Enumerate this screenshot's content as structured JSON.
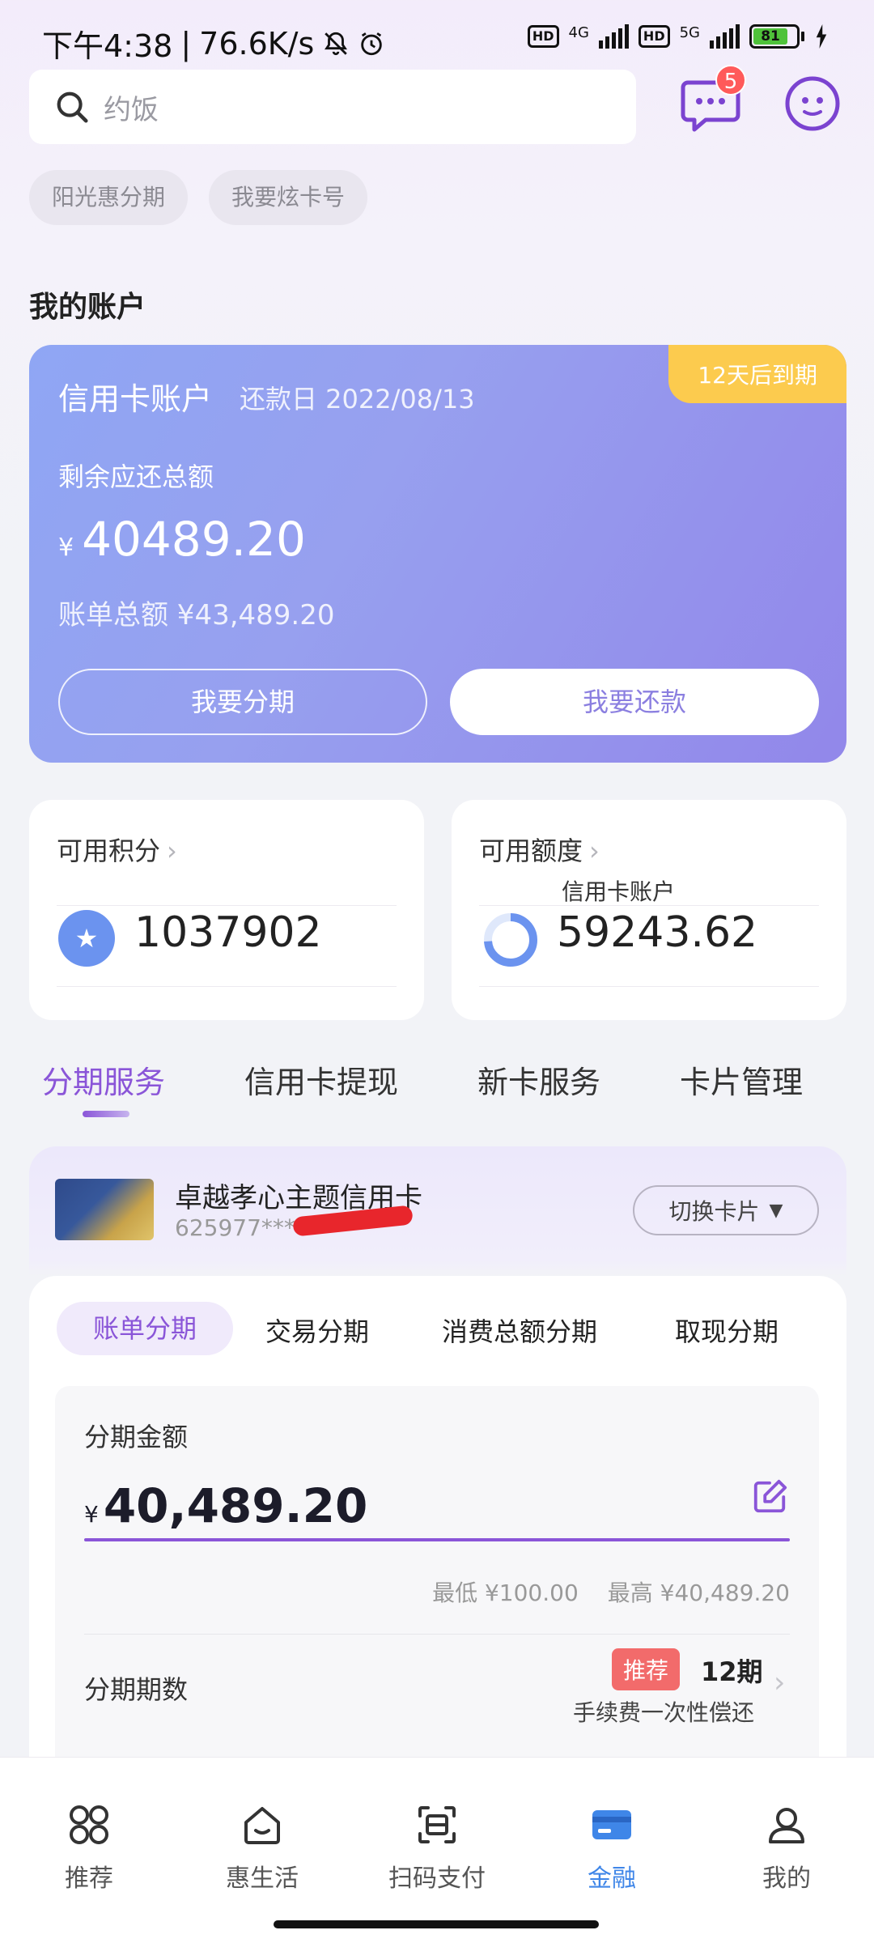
{
  "status_bar": {
    "time": "下午4:38",
    "speed": "76.6K/s",
    "net1": "4G",
    "net2": "5G",
    "hd": "HD",
    "battery": "81"
  },
  "search": {
    "placeholder": "约饭"
  },
  "messages": {
    "badge_count": "5"
  },
  "chips": [
    "阳光惠分期",
    "我要炫卡号"
  ],
  "account_section": {
    "title": "我的账户"
  },
  "account_card": {
    "title": "信用卡账户",
    "due_date": "还款日 2022/08/13",
    "due_tag": "12天后到期",
    "remaining_label": "剩余应还总额",
    "currency": "¥",
    "remaining_amount": "40489.20",
    "bill_total": "账单总额  ¥43,489.20",
    "installment_button": "我要分期",
    "repay_button": "我要还款"
  },
  "points_card": {
    "title": "可用积分",
    "value": "1037902",
    "chevron": "›"
  },
  "limit_card": {
    "title": "可用额度",
    "subtitle": "信用卡账户",
    "value": "59243.62",
    "chevron": "›"
  },
  "service_tabs": [
    "分期服务",
    "信用卡提现",
    "新卡服务",
    "卡片管理"
  ],
  "card": {
    "name": "卓越孝心主题信用卡",
    "number": "625977****",
    "switch_label": "切换卡片",
    "switch_caret": "▼"
  },
  "installment_tabs": [
    "账单分期",
    "交易分期",
    "消费总额分期",
    "取现分期"
  ],
  "installment": {
    "amount_label": "分期金额",
    "currency": "¥",
    "amount": "40,489.20",
    "min": "最低 ¥100.00",
    "max": "最高 ¥40,489.20",
    "period_label": "分期期数",
    "recommend_tag": "推荐",
    "period_value": "12期",
    "period_note": "手续费一次性偿还",
    "chevron": "›"
  },
  "bottom_nav": [
    {
      "label": "推荐",
      "icon": "grid-icon",
      "active": false
    },
    {
      "label": "惠生活",
      "icon": "house-icon",
      "active": false
    },
    {
      "label": "扫码支付",
      "icon": "scan-icon",
      "active": false
    },
    {
      "label": "金融",
      "icon": "card-icon",
      "active": true
    },
    {
      "label": "我的",
      "icon": "user-icon",
      "active": false
    }
  ],
  "colors": {
    "accent": "#8a55d8",
    "card_gradient_start": "#8fa6f4",
    "card_gradient_end": "#9287ea",
    "due_tag": "#fccb4e",
    "nav_active": "#3f86e8",
    "badge": "#ff5a5a"
  }
}
